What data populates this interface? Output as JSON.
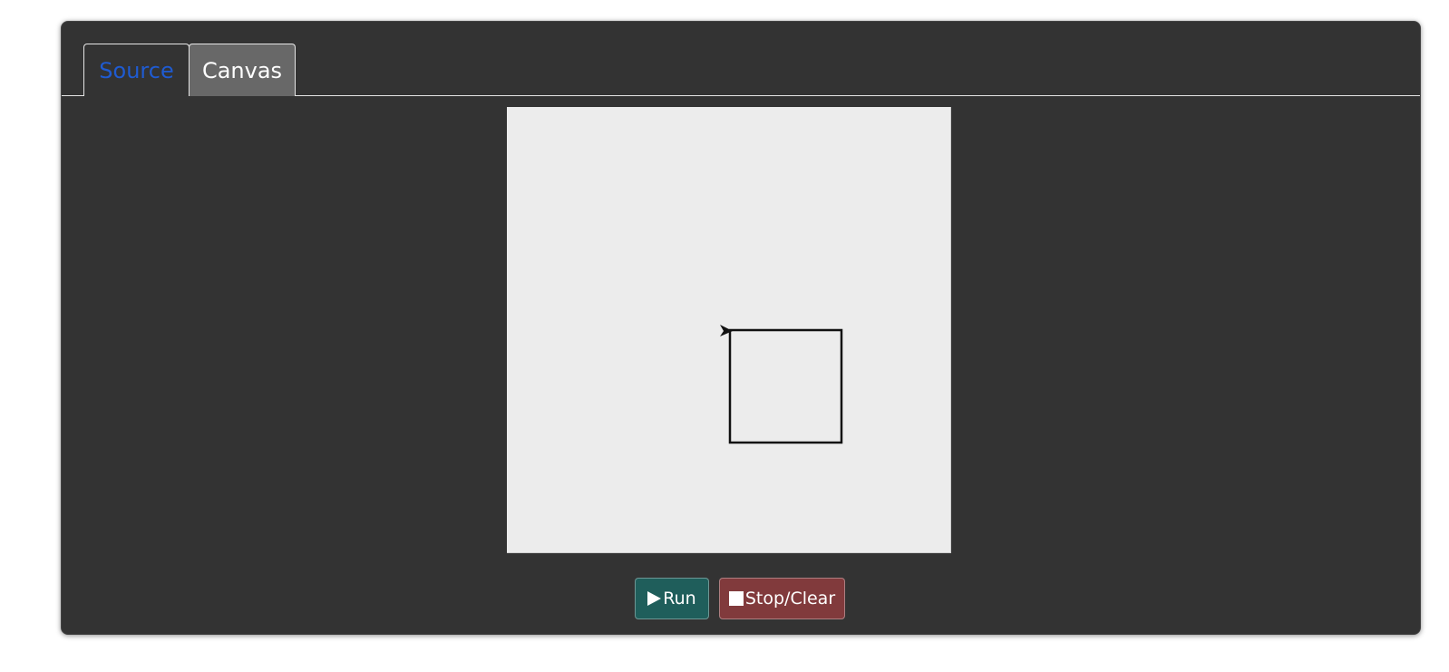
{
  "tabs": [
    {
      "label": "Source",
      "active": false
    },
    {
      "label": "Canvas",
      "active": true
    }
  ],
  "buttons": {
    "run_label": "Run",
    "run_icon": "play-icon",
    "stop_label": "Stop/Clear",
    "stop_icon": "stop-icon"
  },
  "colors": {
    "panel_bg": "#333333",
    "canvas_bg": "#ececec",
    "source_tab_text": "#1f5bd1",
    "canvas_tab_bg": "#686868",
    "run_button": "#1f5e5b",
    "stop_button": "#813a3c"
  }
}
